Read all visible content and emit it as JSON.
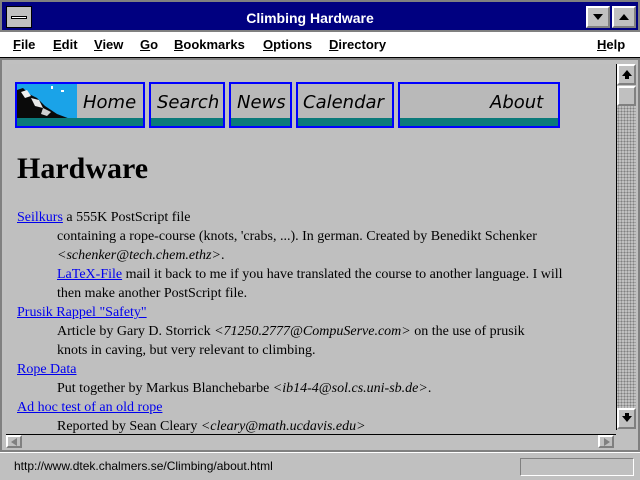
{
  "window": {
    "title": "Climbing Hardware"
  },
  "menubar": {
    "items": [
      {
        "label": "File",
        "key": "F"
      },
      {
        "label": "Edit",
        "key": "E"
      },
      {
        "label": "View",
        "key": "V"
      },
      {
        "label": "Go",
        "key": "G"
      },
      {
        "label": "Bookmarks",
        "key": "B"
      },
      {
        "label": "Options",
        "key": "O"
      },
      {
        "label": "Directory",
        "key": "D"
      },
      {
        "label": "Help",
        "key": "H"
      }
    ]
  },
  "nav": {
    "buttons": [
      {
        "label": "Home",
        "icon": "mountain-landscape"
      },
      {
        "label": "Search"
      },
      {
        "label": "News"
      },
      {
        "label": "Calendar"
      },
      {
        "label": "About"
      }
    ]
  },
  "page": {
    "heading": "Hardware",
    "entries": [
      {
        "link": "Seilkurs",
        "link_suffix": " a 555K PostScript file",
        "line1": "containing a rope-course (knots, 'crabs, ...). In german. Created by Benedikt Schenker",
        "email": "<schenker@tech.chem.ethz>",
        "email_suffix": ".",
        "sublink": "LaTeX-File",
        "sublink_suffix": " mail it back to me if you have translated the course to another language. I will",
        "line4": "then make another PostScript file."
      },
      {
        "link": "Prusik Rappel \"Safety\"",
        "line1_pre": "Article by Gary D. Storrick ",
        "email": "<71250.2777@CompuServe.com>",
        "line1_post": " on the use of prusik",
        "line2": "knots in caving, but very relevant to climbing."
      },
      {
        "link": "Rope Data",
        "line1_pre": "Put together by Markus Blanchebarbe ",
        "email": "<ib14-4@sol.cs.uni-sb.de>",
        "line1_post": "."
      },
      {
        "link": "Ad hoc test of an old rope",
        "line1_pre": "Reported by Sean Cleary ",
        "email": "<cleary@math.ucdavis.edu>"
      }
    ]
  },
  "status": {
    "url": "http://www.dtek.chalmers.se/Climbing/about.html"
  },
  "colors": {
    "titlebar": "#000080",
    "link": "#0000ee",
    "nav_border": "#0000ff",
    "nav_stripe": "#0b7a7a"
  }
}
